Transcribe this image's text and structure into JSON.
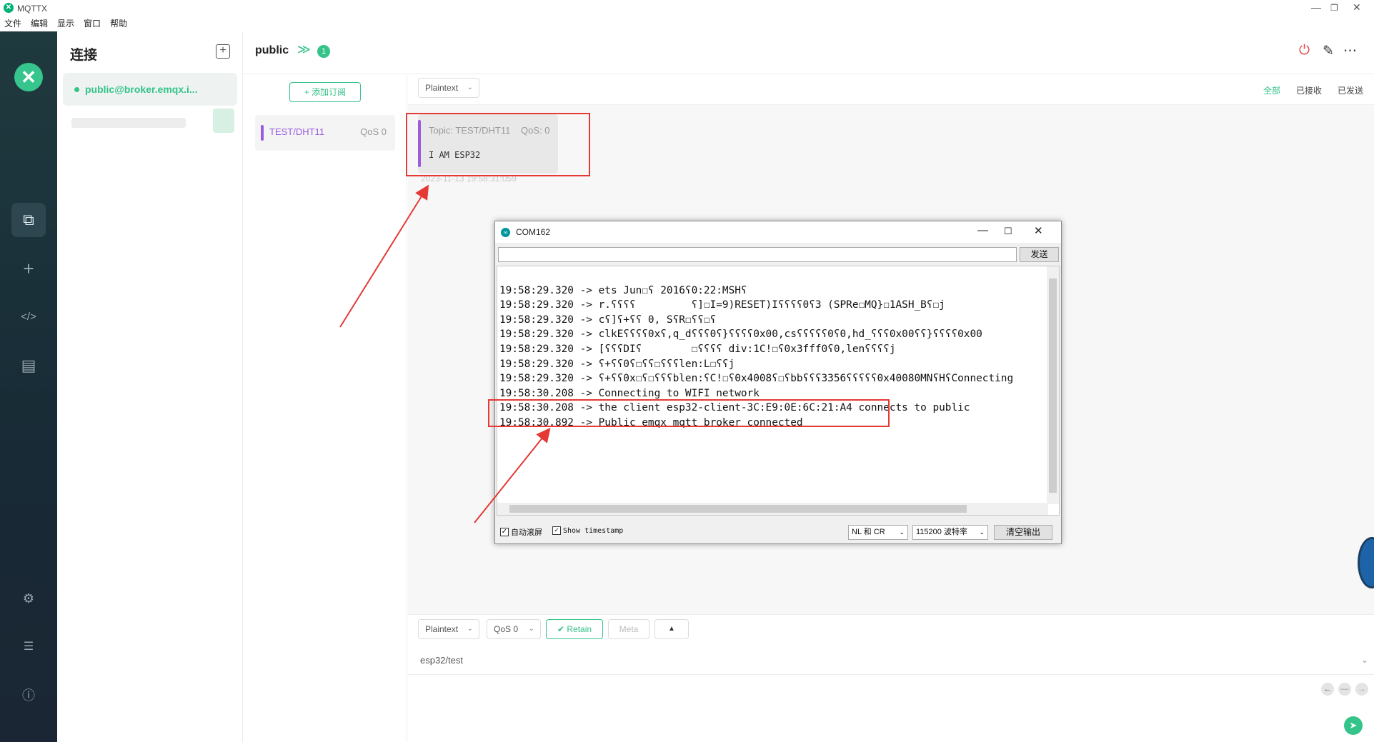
{
  "app": {
    "title": "MQTTX",
    "logo_glyph": "✕"
  },
  "window_controls": {
    "minimize": "—",
    "restore": "❐",
    "close": "✕"
  },
  "menu": [
    "文件",
    "编辑",
    "显示",
    "窗口",
    "帮助"
  ],
  "leftnav": {
    "brand_glyph": "✕",
    "items": [
      {
        "icon": "connections-icon",
        "glyph": "⧉",
        "active": true
      },
      {
        "icon": "plus-icon",
        "glyph": "+",
        "active": false
      },
      {
        "icon": "code-icon",
        "glyph": "</>",
        "active": false
      },
      {
        "icon": "log-icon",
        "glyph": "▤",
        "active": false
      },
      {
        "icon": "settings-icon",
        "glyph": "⚙",
        "active": false
      },
      {
        "icon": "feed-icon",
        "glyph": "☰",
        "active": false
      },
      {
        "icon": "info-icon",
        "glyph": "ⓘ",
        "active": false
      }
    ]
  },
  "connections": {
    "heading": "连接",
    "add_glyph": "+",
    "active_name": "public@broker.emqx.i..."
  },
  "header": {
    "name": "public",
    "chevron": "≫",
    "badge": "1",
    "power_glyph": "⏻",
    "edit_glyph": "✎",
    "more_glyph": "⋯"
  },
  "subscriptions": {
    "add_label": "+ 添加订阅",
    "items": [
      {
        "topic": "TEST/DHT11",
        "qos": "QoS 0",
        "color": "#9b5ce0"
      }
    ]
  },
  "messages": {
    "format": "Plaintext",
    "tabs": [
      "全部",
      "已接收",
      "已发送"
    ],
    "items": [
      {
        "topic": "Topic: TEST/DHT11",
        "qos": "QoS: 0",
        "payload": "I AM ESP32",
        "time": "2023-11-13 19:58:31:059"
      }
    ]
  },
  "publish": {
    "format": "Plaintext",
    "qos": "QoS 0",
    "retain": "Retain",
    "meta": "Meta",
    "expand_glyph": "▲",
    "topic": "esp32/test",
    "send_glyph": "➤",
    "nav": [
      "←",
      "—",
      "→"
    ]
  },
  "serial_monitor": {
    "title": "COM162",
    "send_label": "发送",
    "lines": [
      "19:58:29.320 -> ets Jun☐ʕ 2016ʕ0:22:MSHʕ",
      "19:58:29.320 -> r.ʕʕʕʕ         ʕ]☐I=9)RESET)Iʕʕʕʕ0ʕ3 (SPRe☐MQ}☐1ASH_Bʕ☐j",
      "19:58:29.320 -> cʕ]ʕ+ʕʕ 0, SʕR☐ʕʕ☐ʕ",
      "19:58:29.320 -> clkEʕʕʕʕ0xʕ,q_dʕʕʕ0ʕ}ʕʕʕʕ0x00,csʕʕʕʕʕ0ʕ0,hd_ʕʕʕ0x00ʕʕ}ʕʕʕʕ0x00",
      "19:58:29.320 -> [ʕʕʕDIʕ        ☐ʕʕʕʕ div:1C!☐ʕ0x3fff0ʕ0,lenʕʕʕʕj",
      "19:58:29.320 -> ʕ+ʕʕ0ʕ☐ʕʕ☐ʕʕʕlen:L☐ʕʕj",
      "19:58:29.320 -> ʕ+ʕʕ0x☐ʕ☐ʕʕʕblen:ʕC!☐ʕ0x4008ʕ☐ʕbbʕʕʕ3356ʕʕʕʕʕ0x40080MNʕHʕConnecting",
      "19:58:30.208 -> Connecting to WIFI network",
      "19:58:30.208 -> the client esp32-client-3C:E9:0E:6C:21:A4 connects to public",
      "19:58:30.892 -> Public emqx mqtt broker connected"
    ],
    "autoscroll_label": "自动滚屏",
    "timestamp_label": "Show timestamp",
    "line_ending": "NL 和 CR",
    "baud": "115200 波特率",
    "clear_label": "清空输出"
  }
}
